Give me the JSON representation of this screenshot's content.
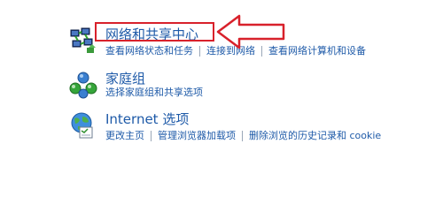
{
  "items": [
    {
      "title": "网络和共享中心",
      "links": [
        "查看网络状态和任务",
        "连接到网络",
        "查看网络计算机和设备"
      ]
    },
    {
      "title": "家庭组",
      "links": [
        "选择家庭组和共享选项"
      ]
    },
    {
      "title": "Internet 选项",
      "links": [
        "更改主页",
        "管理浏览器加载项",
        "删除浏览的历史记录和 cookie"
      ]
    }
  ],
  "icons": {
    "network": "network-sharing-icon",
    "homegroup": "homegroup-icon",
    "internet": "internet-options-icon"
  },
  "colors": {
    "link": "#1e5aa8",
    "highlight": "#d8212b"
  }
}
